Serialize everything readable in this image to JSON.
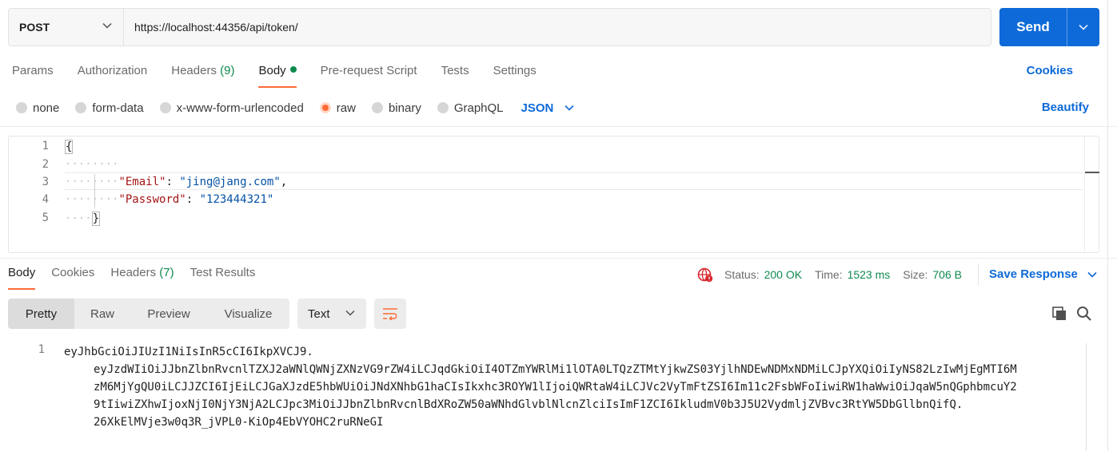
{
  "request": {
    "method": "POST",
    "url": "https://localhost:44356/api/token/",
    "send_label": "Send"
  },
  "request_tabs": {
    "params": "Params",
    "authorization": "Authorization",
    "headers": "Headers",
    "headers_count": "(9)",
    "body": "Body",
    "prerequest": "Pre-request Script",
    "tests": "Tests",
    "settings": "Settings",
    "cookies": "Cookies"
  },
  "body_types": {
    "none": "none",
    "form_data": "form-data",
    "urlencoded": "x-www-form-urlencoded",
    "raw": "raw",
    "binary": "binary",
    "graphql": "GraphQL",
    "format": "JSON",
    "beautify": "Beautify",
    "selected": "raw"
  },
  "editor": {
    "line_numbers": [
      "1",
      "2",
      "3",
      "4",
      "5"
    ],
    "open_brace": "{",
    "close_brace": "}",
    "email_key": "\"Email\"",
    "email_value": "\"jing@jang.com\"",
    "password_key": "\"Password\"",
    "password_value": "\"123444321\""
  },
  "response_tabs": {
    "body": "Body",
    "cookies": "Cookies",
    "headers": "Headers",
    "headers_count": "(7)",
    "test_results": "Test Results"
  },
  "status": {
    "status_label": "Status:",
    "status_value": "200 OK",
    "time_label": "Time:",
    "time_value": "1523 ms",
    "size_label": "Size:",
    "size_value": "706 B",
    "save_response": "Save Response"
  },
  "view": {
    "pretty": "Pretty",
    "raw": "Raw",
    "preview": "Preview",
    "visualize": "Visualize",
    "format": "Text"
  },
  "response_body": {
    "line_number": "1",
    "lines": [
      "eyJhbGciOiJIUzI1NiIsInR5cCI6IkpXVCJ9.",
      "eyJzdWIiOiJJbnZlbnRvcnlTZXJ2aWNlQWNjZXNzVG9rZW4iLCJqdGkiOiI4OTZmYWRlMi1lOTA0LTQzZTMtYjkwZS03YjlhNDEwNDMxNDMiLCJpYXQiOiIyNS82LzIwMjEgMTI6M",
      "zM6MjYgQU0iLCJJZCI6IjEiLCJGaXJzdE5hbWUiOiJNdXNhbG1haCIsIkxhc3ROYW1lIjoiQWRtaW4iLCJVc2VyTmFtZSI6Im11c2FsbWFoIiwiRW1haWwiOiJqaW5nQGphbmcuY2",
      "9tIiwiZXhwIjoxNjI0NjY3NjA2LCJpc3MiOiJJbnZlbnRvcnlBdXRoZW50aWNhdGlvblNlcnZlciIsImF1ZCI6IkludmV0b3J5U2VydmljZVBvc3RtYW5DbGllbnQifQ.",
      "26XkElMVje3w0q3R_jVPL0-KiOp4EbVYOHC2ruRNeGI"
    ]
  },
  "colors": {
    "accent_orange": "#ff6c37",
    "link_blue": "#0d6ad8",
    "success_green": "#0f8a4f"
  }
}
